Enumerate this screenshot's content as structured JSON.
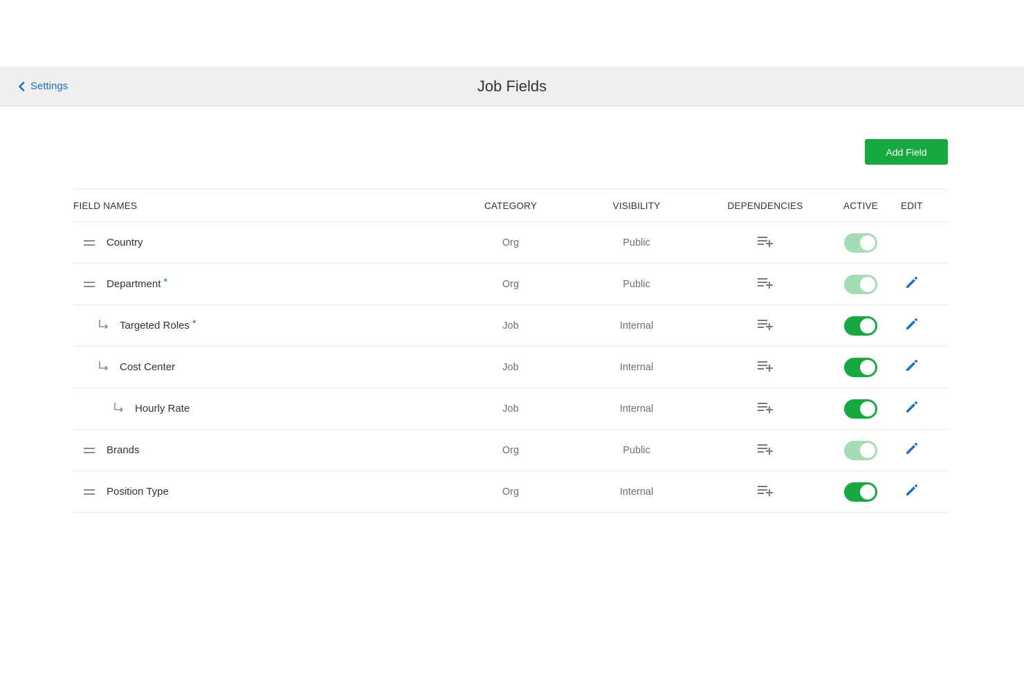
{
  "colors": {
    "accent_blue": "#1a73c9",
    "primary_green": "#15a93f",
    "toggle_disabled": "#a3dcb5",
    "topbar_bg": "#efefef"
  },
  "topbar": {
    "back_label": "Settings",
    "back_icon": "chevron-left-icon",
    "title": "Job Fields"
  },
  "actions": {
    "add_field_label": "Add Field"
  },
  "table": {
    "headers": {
      "field_names": "FIELD NAMES",
      "category": "CATEGORY",
      "visibility": "VISIBILITY",
      "dependencies": "DEPENDENCIES",
      "active": "ACTIVE",
      "edit": "EDIT"
    },
    "rows": [
      {
        "name": "Country",
        "required": false,
        "level": 0,
        "category": "Org",
        "visibility": "Public",
        "active": true,
        "toggle_locked": true,
        "editable": false
      },
      {
        "name": "Department",
        "required": true,
        "required_mark": "*",
        "level": 0,
        "category": "Org",
        "visibility": "Public",
        "active": true,
        "toggle_locked": true,
        "editable": true
      },
      {
        "name": "Targeted Roles",
        "required": true,
        "required_mark": "*",
        "level": 1,
        "category": "Job",
        "visibility": "Internal",
        "active": true,
        "toggle_locked": false,
        "editable": true
      },
      {
        "name": "Cost Center",
        "required": false,
        "level": 1,
        "category": "Job",
        "visibility": "Internal",
        "active": true,
        "toggle_locked": false,
        "editable": true
      },
      {
        "name": "Hourly Rate",
        "required": false,
        "level": 2,
        "category": "Job",
        "visibility": "Internal",
        "active": true,
        "toggle_locked": false,
        "editable": true
      },
      {
        "name": "Brands",
        "required": false,
        "level": 0,
        "category": "Org",
        "visibility": "Public",
        "active": true,
        "toggle_locked": true,
        "editable": true
      },
      {
        "name": "Position Type",
        "required": false,
        "level": 0,
        "category": "Org",
        "visibility": "Internal",
        "active": true,
        "toggle_locked": false,
        "editable": true
      }
    ]
  }
}
